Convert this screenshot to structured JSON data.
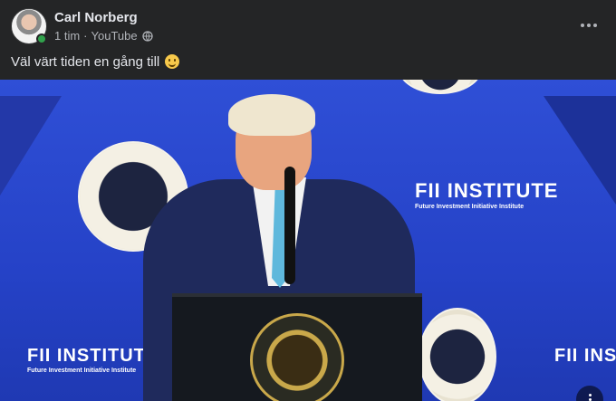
{
  "post": {
    "author": "Carl Norberg",
    "time": "1 tim",
    "source": "YouTube",
    "separator": "·",
    "text": "Väl värt tiden en gång till",
    "text_emoji": "slightly-smiling-face-emoji",
    "audience_icon": "globe-icon",
    "more_icon": "more-horizontal-icon"
  },
  "video": {
    "banner_text": "FII INSTITUTE",
    "banner_tagline": "Future Investment Initiative Institute",
    "menu_icon": "more-vertical-icon",
    "colors": {
      "backdrop": "#2f4fd6",
      "podium": "#15191f",
      "tie": "#5fb8dc"
    }
  },
  "colors": {
    "background": "#242526",
    "text_primary": "#e4e6eb",
    "text_secondary": "#b0b3b8",
    "online": "#31a24c"
  }
}
